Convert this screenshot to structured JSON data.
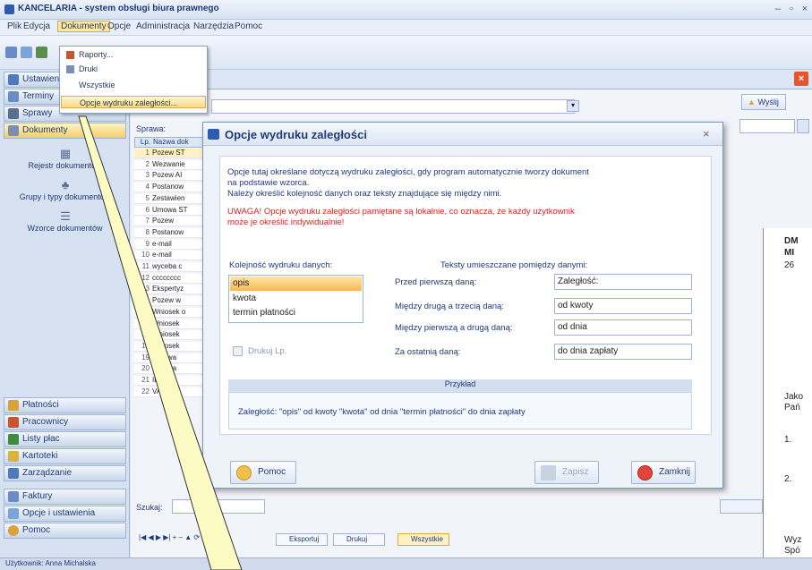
{
  "app": {
    "title": "KANCELARIA - system obsługi biura prawnego"
  },
  "menu": [
    "Plik",
    "Edycja",
    "Dokumenty",
    "Opcje",
    "Administracja",
    "Narzędzia",
    "Pomoc"
  ],
  "dropdown": {
    "items": [
      "Raporty...",
      "Druki",
      "Wszystkie",
      "Opcje wydruku zaległości..."
    ]
  },
  "leftnav": {
    "top_items": [
      "Ustawienia",
      "Terminy",
      "Sprawy",
      "Dokumenty"
    ],
    "sub_items": [
      "Rejestr dokumentów",
      "Grupy i typy dokumentów",
      "Wzorce dokumentów"
    ],
    "bottom_items": [
      "Płatności",
      "Pracownicy",
      "Listy płac",
      "Kartoteki",
      "Zarządzanie",
      "Faktury",
      "Opcje i ustawienia",
      "Pomoc"
    ]
  },
  "main": {
    "sprawa_label": "Sprawa:",
    "wysylij_label": "Wyślij",
    "szukaj_label": "Szukaj:",
    "grid_header": [
      "Lp.",
      "Nazwa dok"
    ],
    "rows": [
      "Pozew ST",
      "Wezwanie",
      "Pozew AI",
      "Postanow",
      "Zestawien",
      "Umowa ST",
      "Pozew",
      "Postanow",
      "e-mail",
      "e-mail",
      "wyceba c",
      "cccccccc",
      "Ekspertyz",
      "Pozew w",
      "Wniosek o",
      "Wniosek",
      "Wniosek",
      "Wniosek",
      "Umowa",
      "Umowa",
      "Ibrelis",
      "VAT"
    ],
    "nav_buttons": [
      "Eksportuj",
      "Drukuj",
      "Wszystkie"
    ]
  },
  "document": {
    "lines": [
      "DM",
      "MI",
      "26",
      "Jako",
      "Pań",
      "1.",
      "2.",
      "Wyz",
      "Spó"
    ]
  },
  "dialog": {
    "title": "Opcje wydruku zaległości",
    "info_line1": "Opcje tutaj określane dotyczą wydruku zaległości, gdy program automatycznie tworzy dokument",
    "info_line2": "na podstawie wzorca.",
    "info_line3": "Należy określić kolejność danych oraz teksty znajdujące się między nimi.",
    "warn_line1": "UWAGA! Opcje wydruku zaległości pamiętane są lokalnie, co oznacza, że każdy użytkownik",
    "warn_line2": "może je określić indywidualnie!",
    "order_label": "Kolejność wydruku danych:",
    "order_items": [
      "opis",
      "kwota",
      "termin płatności"
    ],
    "texts_label": "Teksty umieszczane pomiędzy danymi:",
    "fields": [
      {
        "label": "Przed pierwszą daną:",
        "value": "Zaległość:"
      },
      {
        "label": "Między drugą a trzecią daną:",
        "value": "od kwoty"
      },
      {
        "label": "Między pierwszą a drugą daną:",
        "value": "od dnia"
      },
      {
        "label": "Za ostatnią daną:",
        "value": "do dnia zapłaty"
      }
    ],
    "print_lp_label": "Drukuj Lp.",
    "example_title": "Przykład",
    "example_text": "Zaległość: \"opis\" od kwoty \"kwota\" od dnia \"termin płatności\" do dnia zapłaty",
    "help_button": "Pomoc",
    "save_button": "Zapisz",
    "close_button": "Zamknij"
  },
  "statusbar": {
    "user": "Użytkownik: Anna Michalska"
  },
  "colors": {
    "accent": "#1e3a78",
    "warning": "#c8281e",
    "highlight": "#f7b853"
  }
}
